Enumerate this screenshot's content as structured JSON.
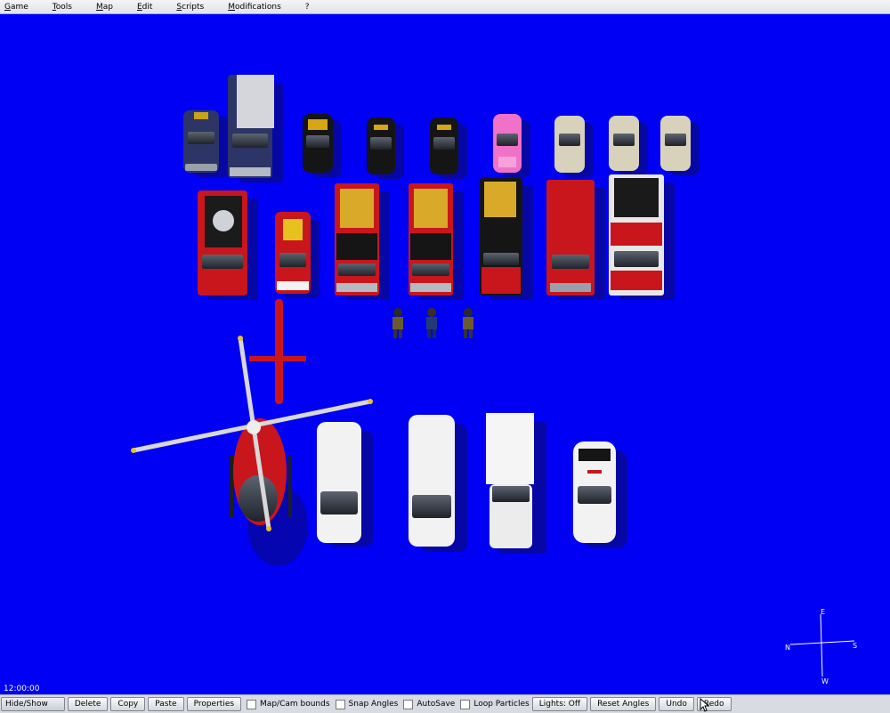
{
  "menu": [
    "Game",
    "Tools",
    "Map",
    "Edit",
    "Scripts",
    "Modifications",
    "?"
  ],
  "clock": "12:00:00",
  "compass": {
    "north": "N",
    "south": "S",
    "east": "E",
    "west": "W"
  },
  "toolbar": {
    "hide_show": "Hide/Show",
    "delete": "Delete",
    "copy": "Copy",
    "paste": "Paste",
    "properties": "Properties",
    "map_cam_bounds": "Map/Cam bounds",
    "snap_angles": "Snap Angles",
    "autosave": "AutoSave",
    "loop_particles": "Loop Particles",
    "lights": "Lights: Off",
    "reset_angles": "Reset Angles",
    "undo": "Undo",
    "redo": "Redo"
  },
  "colors": {
    "viewport_bg": "#0000f5",
    "fire_red": "#c8161c",
    "police_black": "#151515",
    "ambulance_white": "#f2f2f2"
  }
}
